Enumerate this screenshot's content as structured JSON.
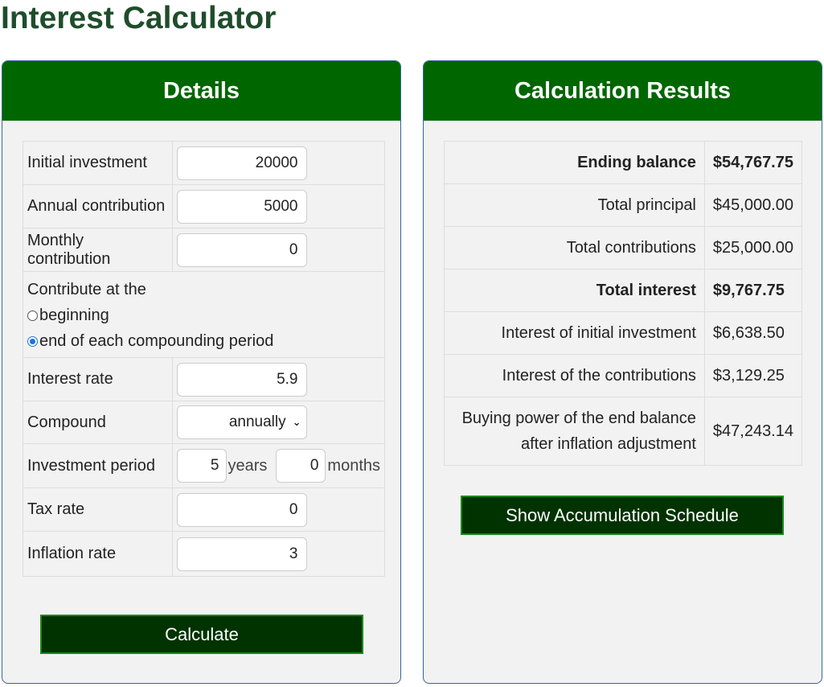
{
  "page": {
    "title": "Interest Calculator"
  },
  "details": {
    "header": "Details",
    "initial_investment": {
      "label": "Initial investment",
      "value": "20000"
    },
    "annual_contribution": {
      "label": "Annual contribution",
      "value": "5000"
    },
    "monthly_contribution": {
      "label": "Monthly contribution",
      "value": "0"
    },
    "contribute_timing": {
      "label": "Contribute at the",
      "options": [
        "beginning",
        "end of each compounding period"
      ],
      "selected": "end of each compounding period"
    },
    "interest_rate": {
      "label": "Interest rate",
      "value": "5.9"
    },
    "compound": {
      "label": "Compound",
      "selected": "annually"
    },
    "investment_period": {
      "label": "Investment period",
      "years_value": "5",
      "years_unit": "years",
      "months_value": "0",
      "months_unit": "months"
    },
    "tax_rate": {
      "label": "Tax rate",
      "value": "0"
    },
    "inflation_rate": {
      "label": "Inflation rate",
      "value": "3"
    },
    "calculate_button": "Calculate"
  },
  "results": {
    "header": "Calculation Results",
    "rows": [
      {
        "label": "Ending balance",
        "value": "$54,767.75",
        "bold": true
      },
      {
        "label": "Total principal",
        "value": "$45,000.00",
        "bold": false
      },
      {
        "label": "Total contributions",
        "value": "$25,000.00",
        "bold": false
      },
      {
        "label": "Total interest",
        "value": "$9,767.75",
        "bold": true
      },
      {
        "label": "Interest of initial investment",
        "value": "$6,638.50",
        "bold": false
      },
      {
        "label": "Interest of the contributions",
        "value": "$3,129.25",
        "bold": false
      }
    ],
    "buying_power": {
      "label_line1": "Buying power of the end balance",
      "label_line2": "after inflation adjustment",
      "value": "$47,243.14"
    },
    "schedule_button": "Show Accumulation Schedule"
  },
  "colors": {
    "title": "#1f4d2b",
    "header_bg": "#006600",
    "button_bg": "#003300",
    "panel_bg": "#f2f2f2"
  }
}
